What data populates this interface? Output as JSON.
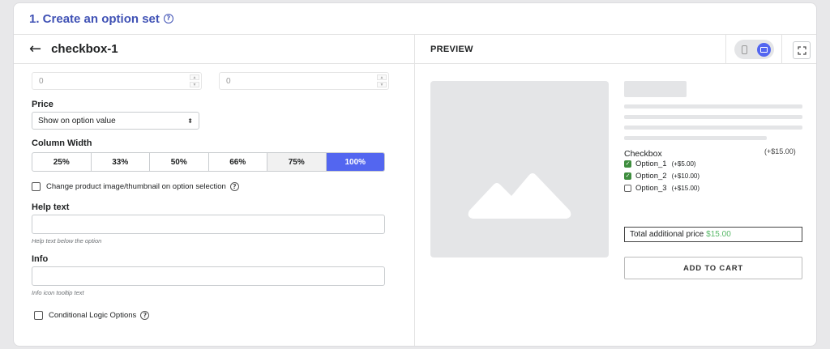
{
  "section": {
    "title": "1. Create an option set"
  },
  "editor": {
    "back_label": "←",
    "title": "checkbox-1",
    "min_value": "0",
    "max_value": "0",
    "price_label": "Price",
    "price_select": "Show on option value",
    "column_width_label": "Column Width",
    "column_widths": [
      "25%",
      "33%",
      "50%",
      "66%",
      "75%",
      "100%"
    ],
    "column_width_selected": "100%",
    "change_image_label": "Change product image/thumbnail on option selection",
    "help_text_label": "Help text",
    "help_text_hint": "Help text below the option",
    "info_label": "Info",
    "info_hint": "Info icon tooltip text",
    "conditional_label": "Conditional Logic Options"
  },
  "preview": {
    "title": "PREVIEW",
    "option_group_label": "Checkbox",
    "option_group_price": "(+$15.00)",
    "options": [
      {
        "label": "Option_1",
        "price": "(+$5.00)",
        "checked": true
      },
      {
        "label": "Option_2",
        "price": "(+$10.00)",
        "checked": true
      },
      {
        "label": "Option_3",
        "price": "(+$15.00)",
        "checked": false
      }
    ],
    "total_label": "Total additional price",
    "total_value": "$15.00",
    "add_to_cart": "ADD TO CART"
  },
  "colors": {
    "accent": "#5366f0",
    "title": "#4052b5",
    "price_green": "#58b968",
    "checkbox_green": "#3e8d3e"
  }
}
